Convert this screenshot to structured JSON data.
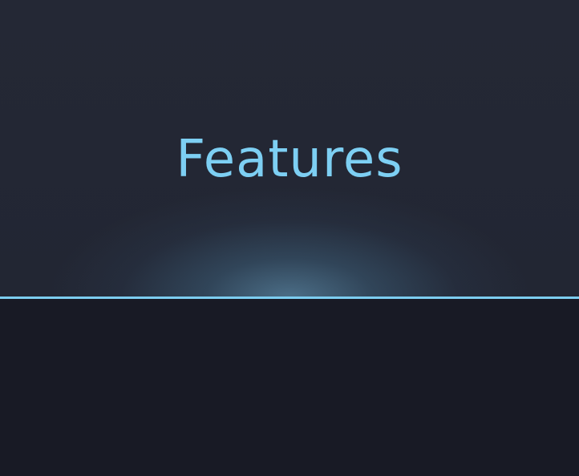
{
  "hero": {
    "title": "Features"
  },
  "colors": {
    "accent": "#7dcff3",
    "hero_background": "#232734",
    "page_background": "#181a25",
    "divider": "#7ccdf0"
  }
}
